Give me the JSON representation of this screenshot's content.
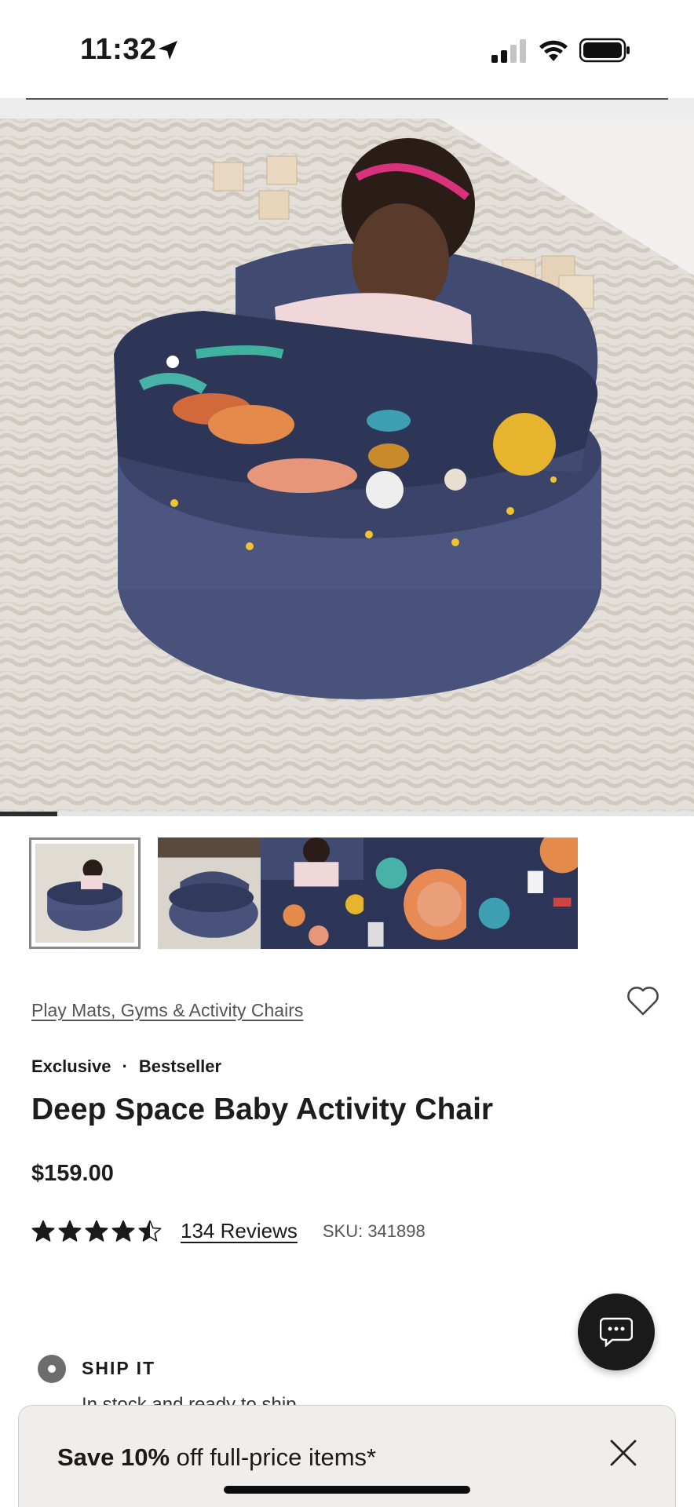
{
  "status_bar": {
    "time": "11:32"
  },
  "gallery": {
    "current_index": 1,
    "image_count": 5,
    "progress_fraction": 0.083,
    "thumbnails": [
      {
        "alt": "chair-with-baby"
      },
      {
        "alt": "empty-chair"
      },
      {
        "alt": "baby-top-view"
      },
      {
        "alt": "planets-closeup"
      },
      {
        "alt": "astronaut-closeup"
      }
    ]
  },
  "product": {
    "breadcrumb": "Play Mats, Gyms & Activity Chairs",
    "tag_exclusive": "Exclusive",
    "tag_separator": "·",
    "tag_bestseller": "Bestseller",
    "title": "Deep Space Baby Activity Chair",
    "price": "$159.00",
    "rating": 4.5,
    "reviews_label": "134 Reviews",
    "sku": "SKU: 341898"
  },
  "shipping": {
    "label": "SHIP IT",
    "subtext": "In stock and ready to ship"
  },
  "promo": {
    "bold": "Save 10%",
    "rest": " off full-price items*"
  },
  "colors": {
    "accent": "#1a1a1a",
    "chair_navy": "#3f4a6e"
  }
}
